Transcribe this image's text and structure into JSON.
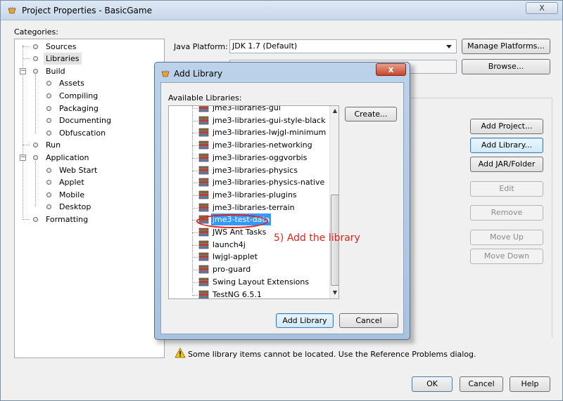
{
  "window": {
    "title": "Project Properties - BasicGame",
    "close_label": "X"
  },
  "categories": {
    "label": "Categories:",
    "items": [
      {
        "label": "Sources"
      },
      {
        "label": "Libraries"
      },
      {
        "label": "Build"
      },
      {
        "label": "Assets"
      },
      {
        "label": "Compiling"
      },
      {
        "label": "Packaging"
      },
      {
        "label": "Documenting"
      },
      {
        "label": "Obfuscation"
      },
      {
        "label": "Run"
      },
      {
        "label": "Application"
      },
      {
        "label": "Web Start"
      },
      {
        "label": "Applet"
      },
      {
        "label": "Mobile"
      },
      {
        "label": "Desktop"
      },
      {
        "label": "Formatting"
      }
    ]
  },
  "java_platform": {
    "label": "Java Platform:",
    "value": "JDK 1.7 (Default)",
    "manage_button": "Manage Platforms...",
    "browse_button": "Browse..."
  },
  "side_buttons": {
    "add_project": "Add Project...",
    "add_library": "Add Library...",
    "add_jar": "Add JAR/Folder",
    "edit": "Edit",
    "remove": "Remove",
    "move_up": "Move Up",
    "move_down": "Move Down"
  },
  "warning": {
    "icon": "warning-icon",
    "text": "Some library items cannot be located. Use the Reference Problems dialog."
  },
  "footer": {
    "ok": "OK",
    "cancel": "Cancel",
    "help": "Help"
  },
  "dialog": {
    "title": "Add Library",
    "close_label": "x",
    "available_label": "Available Libraries:",
    "create_button": "Create...",
    "add_button": "Add Library",
    "cancel_button": "Cancel",
    "libraries": [
      {
        "label": "jme3-libraries-gui"
      },
      {
        "label": "jme3-libraries-gui-style-black"
      },
      {
        "label": "jme3-libraries-lwjgl-minimum"
      },
      {
        "label": "jme3-libraries-networking"
      },
      {
        "label": "jme3-libraries-oggvorbis"
      },
      {
        "label": "jme3-libraries-physics"
      },
      {
        "label": "jme3-libraries-physics-native"
      },
      {
        "label": "jme3-libraries-plugins"
      },
      {
        "label": "jme3-libraries-terrain"
      },
      {
        "label": "jme3-test-data"
      },
      {
        "label": "JWS Ant Tasks"
      },
      {
        "label": "launch4j"
      },
      {
        "label": "lwjgl-applet"
      },
      {
        "label": "pro-guard"
      },
      {
        "label": "Swing Layout Extensions"
      },
      {
        "label": "TestNG 6.5.1"
      }
    ]
  },
  "annotation": {
    "text": "5) Add the library",
    "color": "#e2231a"
  }
}
